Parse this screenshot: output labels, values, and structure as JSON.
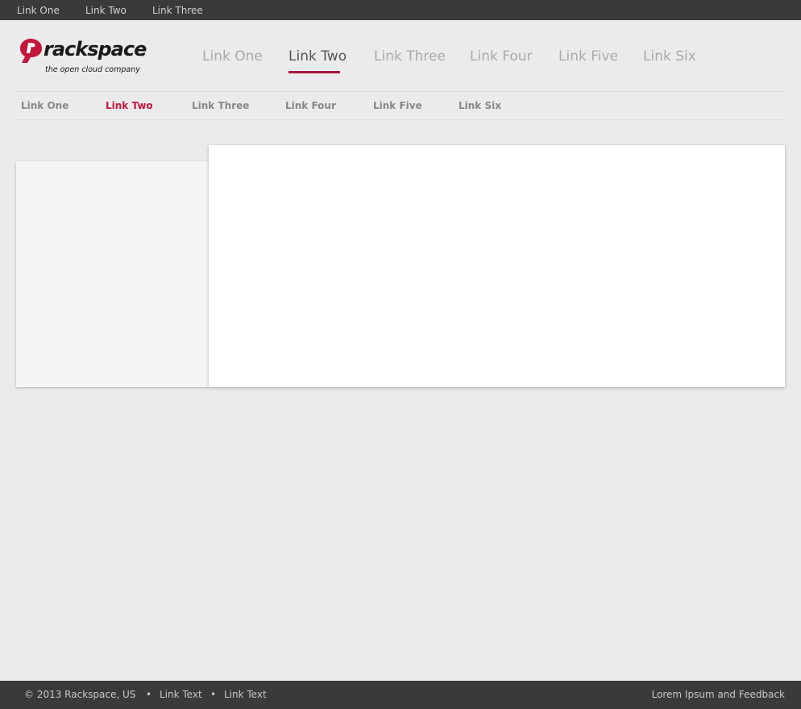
{
  "topbar": {
    "links": [
      "Link One",
      "Link Two",
      "Link Three"
    ]
  },
  "logo": {
    "brand": "rackspace",
    "registered": "®",
    "tagline": "the open cloud company"
  },
  "primary_nav": {
    "items": [
      "Link One",
      "Link Two",
      "Link Three",
      "Link Four",
      "Link Five",
      "Link Six"
    ],
    "active_index": 1
  },
  "secondary_nav": {
    "items": [
      "Link One",
      "Link Two",
      "Link Three",
      "Link Four",
      "Link Five",
      "Link Six"
    ],
    "active_index": 1
  },
  "footer": {
    "copyright": "© 2013 Rackspace, US",
    "separator": "•",
    "links": [
      "Link Text",
      "Link Text"
    ],
    "feedback": "Lorem Ipsum and Feedback"
  },
  "colors": {
    "accent": "#c4173c",
    "topbar_bg": "#3a3a3a",
    "page_bg": "#ecebec"
  }
}
